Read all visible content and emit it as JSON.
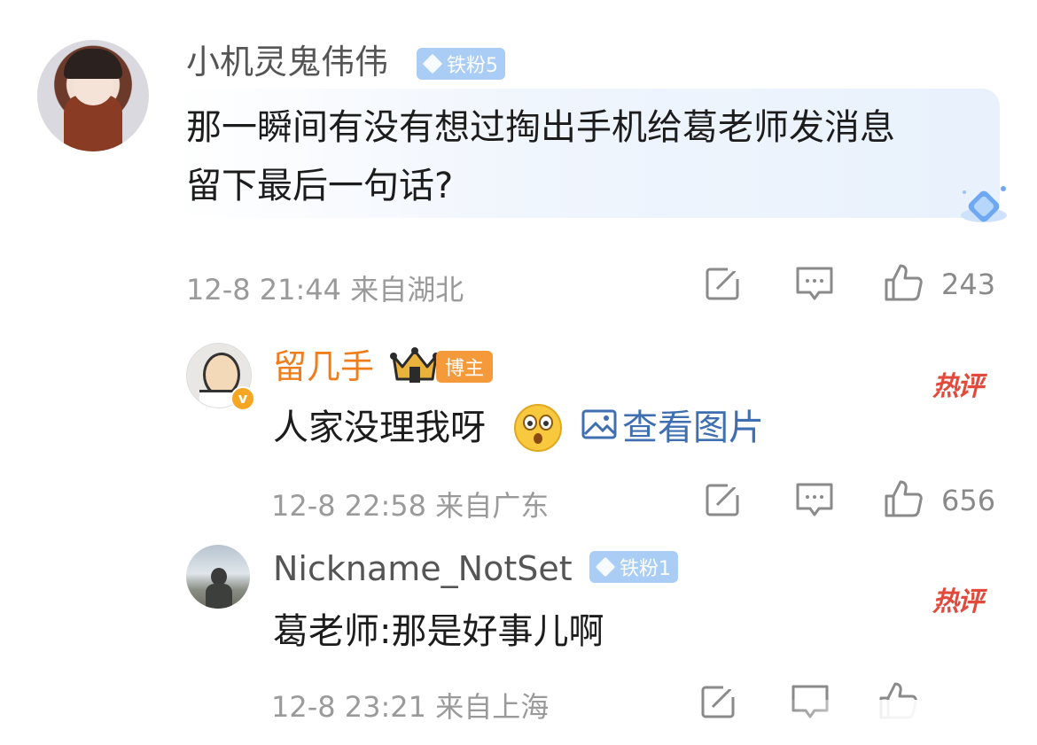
{
  "comment": {
    "username": "小机灵鬼伟伟",
    "fan_badge": "铁粉5",
    "text_line1": "那一瞬间有没有想过掏出手机给葛老师发消息",
    "text_line2": "留下最后一句话?",
    "meta": "12-8 21:44 来自湖北",
    "likes": "243"
  },
  "replies": [
    {
      "username": "留几手",
      "host_badge": "博主",
      "hot_label": "热评",
      "text": "人家没理我呀",
      "view_image": "查看图片",
      "meta": "12-8 22:58 来自广东",
      "likes": "656"
    },
    {
      "username": "Nickname_NotSet",
      "fan_badge": "铁粉1",
      "hot_label": "热评",
      "text": "葛老师:那是好事儿啊",
      "meta": "12-8 23:21 来自上海"
    }
  ],
  "colors": {
    "username_gray": "#555555",
    "host_name_orange": "#f07d1c",
    "link_blue": "#3f6fb0",
    "hot_red": "#e24a3c",
    "bubble_bg": "#eaf2fc"
  }
}
